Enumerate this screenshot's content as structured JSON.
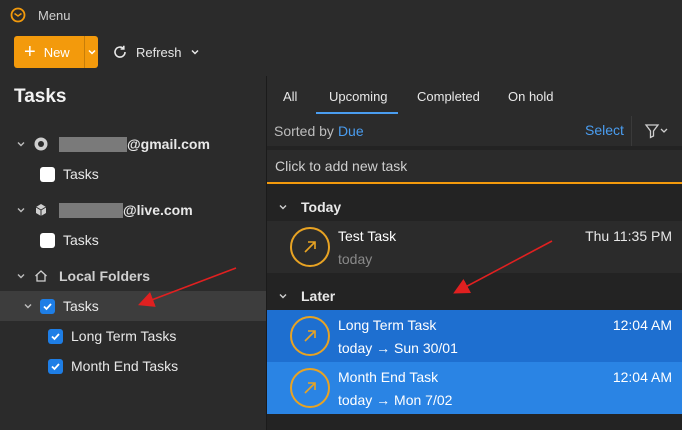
{
  "window": {
    "menu_label": "Menu"
  },
  "toolbar": {
    "new_label": "New",
    "refresh_label": "Refresh"
  },
  "sidebar": {
    "title": "Tasks",
    "accounts": [
      {
        "domain": "@gmail.com",
        "icon": "gmail-account-icon",
        "folder": "Tasks",
        "checked": false
      },
      {
        "domain": "@live.com",
        "icon": "live-account-icon",
        "folder": "Tasks",
        "checked": false
      }
    ],
    "local_folders": {
      "label": "Local Folders",
      "items": [
        {
          "label": "Tasks",
          "checked": true
        },
        {
          "label": "Long Term Tasks",
          "checked": true
        },
        {
          "label": "Month End Tasks",
          "checked": true
        }
      ]
    }
  },
  "main": {
    "tabs": [
      {
        "label": "All",
        "active": false
      },
      {
        "label": "Upcoming",
        "active": true
      },
      {
        "label": "Completed",
        "active": false
      },
      {
        "label": "On hold",
        "active": false
      }
    ],
    "sorted_by_label": "Sorted by",
    "sorted_by_value": "Due",
    "select_label": "Select",
    "add_task_placeholder": "Click to add new task",
    "groups": [
      {
        "label": "Today",
        "tasks": [
          {
            "title": "Test Task",
            "subtitle": "today",
            "time": "Thu 11:35 PM",
            "selected": false
          }
        ]
      },
      {
        "label": "Later",
        "tasks": [
          {
            "title": "Long Term Task",
            "subtitle": "today → Sun 30/01",
            "time": "12:04 AM",
            "selected": true
          },
          {
            "title": "Month End Task",
            "subtitle": "today → Mon 7/02",
            "time": "12:04 AM",
            "selected": true
          }
        ]
      }
    ]
  },
  "colors": {
    "accent_orange": "#f39a0c",
    "accent_blue": "#4a9df0",
    "selection_blue": "#1e6fd0",
    "annotation_red": "#e02020"
  }
}
